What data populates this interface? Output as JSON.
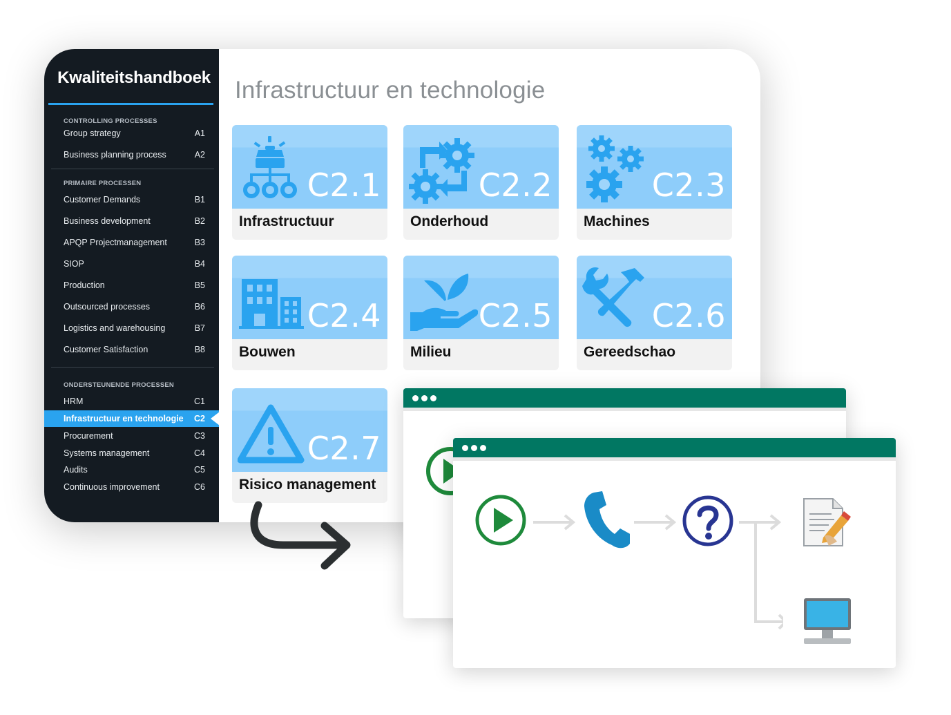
{
  "app": {
    "brand": "Kwaliteitshandboek",
    "title": "Infrastructuur en technologie",
    "accent": "#2aa3ef",
    "sidebar_bg": "#141b22"
  },
  "sidebar": {
    "sections": [
      {
        "heading": "CONTROLLING PROCESSES",
        "items": [
          {
            "label": "Group strategy",
            "code": "A1"
          },
          {
            "label": "Business planning process",
            "code": "A2"
          }
        ]
      },
      {
        "heading": "PRIMAIRE PROCESSEN",
        "items": [
          {
            "label": "Customer Demands",
            "code": "B1"
          },
          {
            "label": "Business development",
            "code": "B2"
          },
          {
            "label": "APQP Projectmanagement",
            "code": "B3"
          },
          {
            "label": "SIOP",
            "code": "B4"
          },
          {
            "label": "Production",
            "code": "B5"
          },
          {
            "label": "Outsourced processes",
            "code": "B6"
          },
          {
            "label": "Logistics and warehousing",
            "code": "B7"
          },
          {
            "label": "Customer Satisfaction",
            "code": "B8"
          }
        ]
      },
      {
        "heading": "ONDERSTEUNENDE PROCESSEN",
        "items": [
          {
            "label": "HRM",
            "code": "C1"
          },
          {
            "label": "Infrastructuur en technologie",
            "code": "C2",
            "active": true
          },
          {
            "label": "Procurement",
            "code": "C3"
          },
          {
            "label": "Systems management",
            "code": "C4"
          },
          {
            "label": "Audits",
            "code": "C5"
          },
          {
            "label": "Continuous improvement",
            "code": "C6"
          }
        ]
      }
    ]
  },
  "tiles": [
    {
      "code": "C2.1",
      "name": "Infrastructuur",
      "icon": "hierarchy-icon"
    },
    {
      "code": "C2.2",
      "name": "Onderhoud",
      "icon": "gears-cycle-icon"
    },
    {
      "code": "C2.3",
      "name": "Machines",
      "icon": "gears-icon"
    },
    {
      "code": "C2.4",
      "name": "Bouwen",
      "icon": "buildings-icon"
    },
    {
      "code": "C2.5",
      "name": "Milieu",
      "icon": "hand-leaf-icon"
    },
    {
      "code": "C2.6",
      "name": "Gereedschao",
      "icon": "tools-icon"
    },
    {
      "code": "C2.7",
      "name": "Risico management",
      "icon": "warning-icon"
    }
  ],
  "process_flow": {
    "bar_color": "#017762",
    "steps": [
      "play-icon",
      "phone-icon",
      "question-icon",
      "document-pen-icon",
      "monitor-icon"
    ]
  }
}
